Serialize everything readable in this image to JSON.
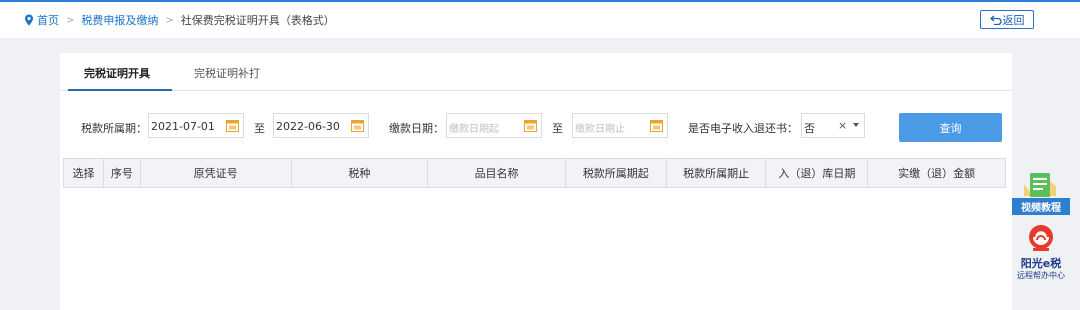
{
  "breadcrumb": {
    "home": "首页",
    "level1": "税费申报及缴纳",
    "current": "社保费完税证明开具（表格式）",
    "separator": ">"
  },
  "back_button": "返回",
  "tabs": [
    {
      "label": "完税证明开具",
      "active": true
    },
    {
      "label": "完税证明补打",
      "active": false
    }
  ],
  "form": {
    "tax_period_label": "税款所属期：",
    "tax_period_start": "2021-07-01",
    "to_label": "至",
    "tax_period_end": "2022-06-30",
    "pay_date_label": "缴款日期：",
    "pay_date_start_placeholder": "缴款日期起",
    "pay_date_end_placeholder": "缴款日期止",
    "refund_label": "是否电子收入退还书：",
    "refund_value": "否",
    "refund_clear": "×",
    "query_button": "查询"
  },
  "table": {
    "columns": [
      "选择",
      "序号",
      "原凭证号",
      "税种",
      "品目名称",
      "税款所属期起",
      "税款所属期止",
      "入（退）库日期",
      "实缴（退）金额"
    ],
    "rows": []
  },
  "floating": {
    "video_label": "视频教程",
    "help_title": "阳光e税",
    "help_subtitle": "远程帮办中心"
  },
  "colors": {
    "accent": "#2e7ed9",
    "query_button": "#4a9ae6",
    "tab_underline": "#2a6ab8",
    "calendar_icon": "#e8a530"
  }
}
